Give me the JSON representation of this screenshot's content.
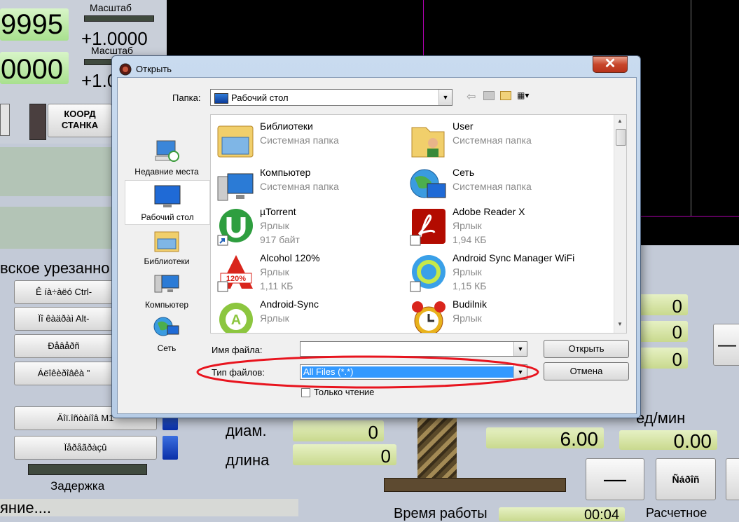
{
  "background": {
    "masshtab_label_1": "Масштаб",
    "masshtab_value_1": "+1.0000",
    "masshtab_label_2": "Масштаб",
    "masshtab_value_2": "+1.0",
    "dro_1": "9995",
    "dro_2": "0000",
    "koord_btn_line1": "КООРД",
    "koord_btn_line2": "СТАНКА",
    "profile_text": "вское урезанно",
    "menu_btn_1": "Ê íà÷àëó Ctrl-",
    "menu_btn_2": "Ïî êàäðàì Alt-",
    "menu_btn_3": "Ðåâåðñ",
    "menu_btn_4": "Áëîêèðîâêà \"",
    "menu_btn_5": "Äîï.îñòàíîâ M1",
    "menu_btn_6": "Ïåðåãðàçû",
    "zaderzhka": "Задержка",
    "bottom_left_text": "яние....",
    "diam_label": "диам.",
    "dlina_label": "длина",
    "diam_value": "0",
    "dlina_value": "0",
    "right_dro_1": "0",
    "right_dro_2": "0",
    "right_dro_3": "0",
    "ed_min_label": "ед/мин",
    "feed_value": "6.00",
    "feed_value_2": "0.00",
    "minus_btn": "—",
    "reset_btn": "Ñáðîñ",
    "vremya_label": "Время работы",
    "vremya_value": "00:04",
    "raschetnoe_label": "Расчетное"
  },
  "dialog": {
    "title": "Открыть",
    "close": "✕",
    "folder_label": "Папка:",
    "folder_value": "Рабочий стол",
    "places": [
      {
        "label": "Недавние места"
      },
      {
        "label": "Рабочий стол"
      },
      {
        "label": "Библиотеки"
      },
      {
        "label": "Компьютер"
      },
      {
        "label": "Сеть"
      }
    ],
    "files": [
      {
        "name": "Библиотеки",
        "sub1": "Системная папка",
        "sub2": ""
      },
      {
        "name": "User",
        "sub1": "Системная папка",
        "sub2": ""
      },
      {
        "name": "Компьютер",
        "sub1": "Системная папка",
        "sub2": ""
      },
      {
        "name": "Сеть",
        "sub1": "Системная папка",
        "sub2": ""
      },
      {
        "name": "µTorrent",
        "sub1": "Ярлык",
        "sub2": "917 байт"
      },
      {
        "name": "Adobe Reader X",
        "sub1": "Ярлык",
        "sub2": "1,94 КБ"
      },
      {
        "name": "Alcohol 120%",
        "sub1": "Ярлык",
        "sub2": "1,11 КБ"
      },
      {
        "name": "Android Sync Manager WiFi",
        "sub1": "Ярлык",
        "sub2": "1,15 КБ"
      },
      {
        "name": "Android-Sync",
        "sub1": "Ярлык",
        "sub2": ""
      },
      {
        "name": "Budilnik",
        "sub1": "Ярлык",
        "sub2": ""
      }
    ],
    "filename_label": "Имя файла:",
    "filename_value": "",
    "filetype_label": "Тип файлов:",
    "filetype_value": "All Files (*.*)",
    "readonly_label": "Только чтение",
    "open_button": "Открыть",
    "cancel_button": "Отмена"
  },
  "colors": {
    "highlight_circle": "#e8141e",
    "selection_blue": "#3399ff"
  }
}
